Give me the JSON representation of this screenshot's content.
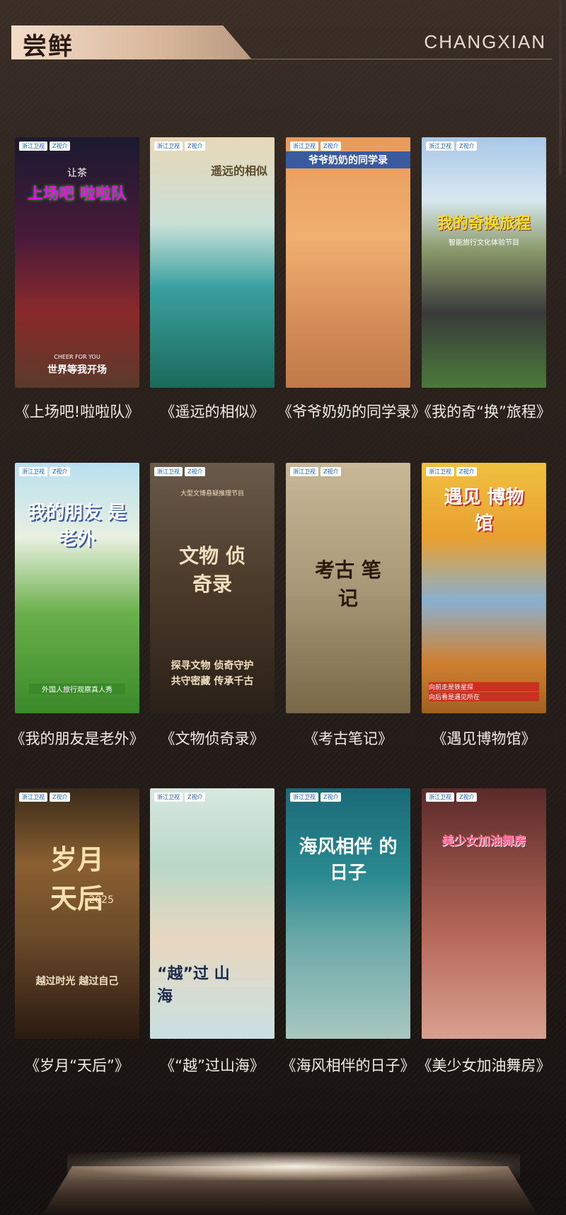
{
  "header": {
    "title": "尝鲜",
    "subtitle": "CHANGXIAN"
  },
  "logos": {
    "zj": "浙江卫视",
    "app": "Z视介"
  },
  "programs": [
    {
      "caption": "《上场吧!啦啦队》",
      "poster_title": "上场吧 啦啦队",
      "poster_top": "让茶",
      "poster_tag": "CHEER FOR YOU",
      "poster_tag2": "世界等我开场"
    },
    {
      "caption": "《遥远的相似》",
      "poster_title": "遥远的相似",
      "poster_top": "",
      "poster_tag": "",
      "poster_tag2": ""
    },
    {
      "caption": "《爷爷奶奶的同学录》",
      "poster_title": "爷爷奶奶的同学录",
      "poster_top": "",
      "poster_tag": "",
      "poster_tag2": ""
    },
    {
      "caption": "《我的奇“换”旅程》",
      "poster_title": "我的奇换旅程",
      "poster_top": "",
      "poster_tag": "智能旅行文化体验节目",
      "poster_tag2": ""
    },
    {
      "caption": "《我的朋友是老外》",
      "poster_title": "我的朋友 是老外",
      "poster_top": "",
      "poster_tag": "外国人旅行观察真人秀",
      "poster_tag2": ""
    },
    {
      "caption": "《文物侦奇录》",
      "poster_title": "文物 侦奇录",
      "poster_top": "大型文博悬疑推理节目",
      "poster_tag": "探寻文物 侦奇守护",
      "poster_tag2": "共守密藏 传承千古"
    },
    {
      "caption": "《考古笔记》",
      "poster_title": "考古 笔记",
      "poster_top": "",
      "poster_tag": "",
      "poster_tag2": ""
    },
    {
      "caption": "《遇见博物馆》",
      "poster_title": "遇见 博物馆",
      "poster_top": "",
      "poster_tag": "向前走是铁星探",
      "poster_tag2": "向后看是遇见所在"
    },
    {
      "caption": "《岁月“天后”》",
      "poster_title": "岁月 天后",
      "poster_top": "",
      "poster_tag": "越过时光  越过自己",
      "poster_tag2": "2025"
    },
    {
      "caption": "《“越”过山海》",
      "poster_title": "“越”过 山海",
      "poster_top": "",
      "poster_tag": "",
      "poster_tag2": ""
    },
    {
      "caption": "《海风相伴的日子》",
      "poster_title": "海风相伴 的日子",
      "poster_top": "",
      "poster_tag": "",
      "poster_tag2": ""
    },
    {
      "caption": "《美少女加油舞房》",
      "poster_title": "美少女加油舞房",
      "poster_top": "",
      "poster_tag": "",
      "poster_tag2": ""
    }
  ],
  "colors": {
    "accent_gold": "#d9b89c",
    "bg_dark": "#251d19"
  }
}
